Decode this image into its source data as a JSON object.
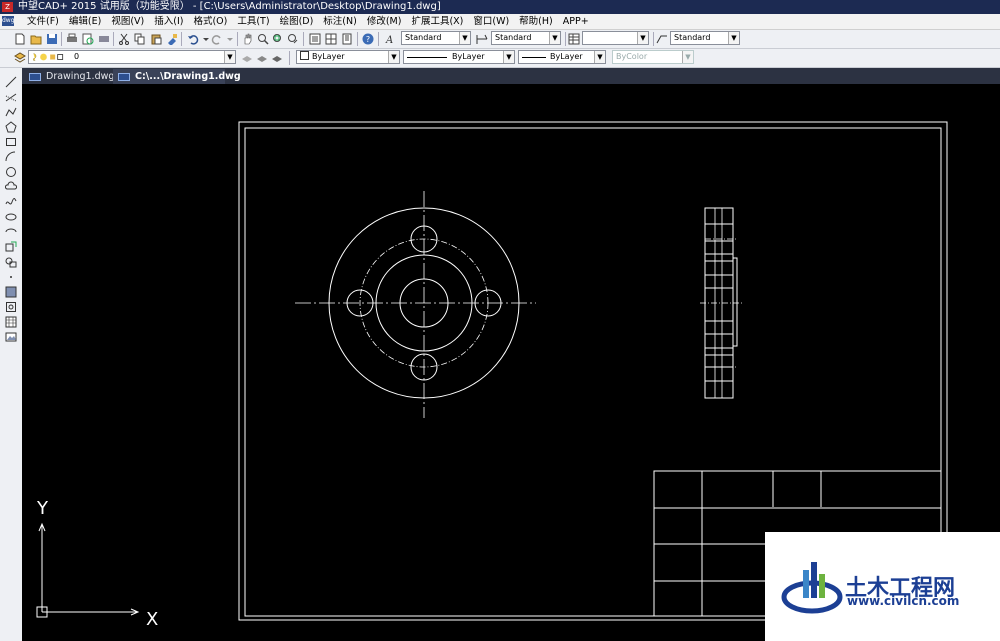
{
  "window": {
    "title": "中望CAD+ 2015 试用版（功能受限） - [C:\\Users\\Administrator\\Desktop\\Drawing1.dwg]",
    "app_icon": "Z"
  },
  "menubar": {
    "doc_icon": "dwg",
    "items": [
      "文件(F)",
      "编辑(E)",
      "视图(V)",
      "插入(I)",
      "格式(O)",
      "工具(T)",
      "绘图(D)",
      "标注(N)",
      "修改(M)",
      "扩展工具(X)",
      "窗口(W)",
      "帮助(H)",
      "APP+"
    ]
  },
  "toolbar1": {
    "text_style": "Standard",
    "dim_style": "Standard",
    "table_style": "",
    "multileader_style": "Standard"
  },
  "toolbar2": {
    "layer": "0",
    "color": "ByLayer",
    "linetype": "ByLayer",
    "lineweight": "ByLayer",
    "plotstyle": "ByColor",
    "dropdown_arrow": "▼"
  },
  "tabs": [
    {
      "label": "Drawing1.dwg",
      "active": false
    },
    {
      "label": "C:\\...\\Drawing1.dwg",
      "active": true
    }
  ],
  "ucs": {
    "x_label": "X",
    "y_label": "Y"
  },
  "watermark": {
    "name": "土木工程网",
    "url": "www.civilcn.com"
  },
  "colors": {
    "canvas": "#000000",
    "line": "#ffffff",
    "accent": "#1c3f94"
  }
}
